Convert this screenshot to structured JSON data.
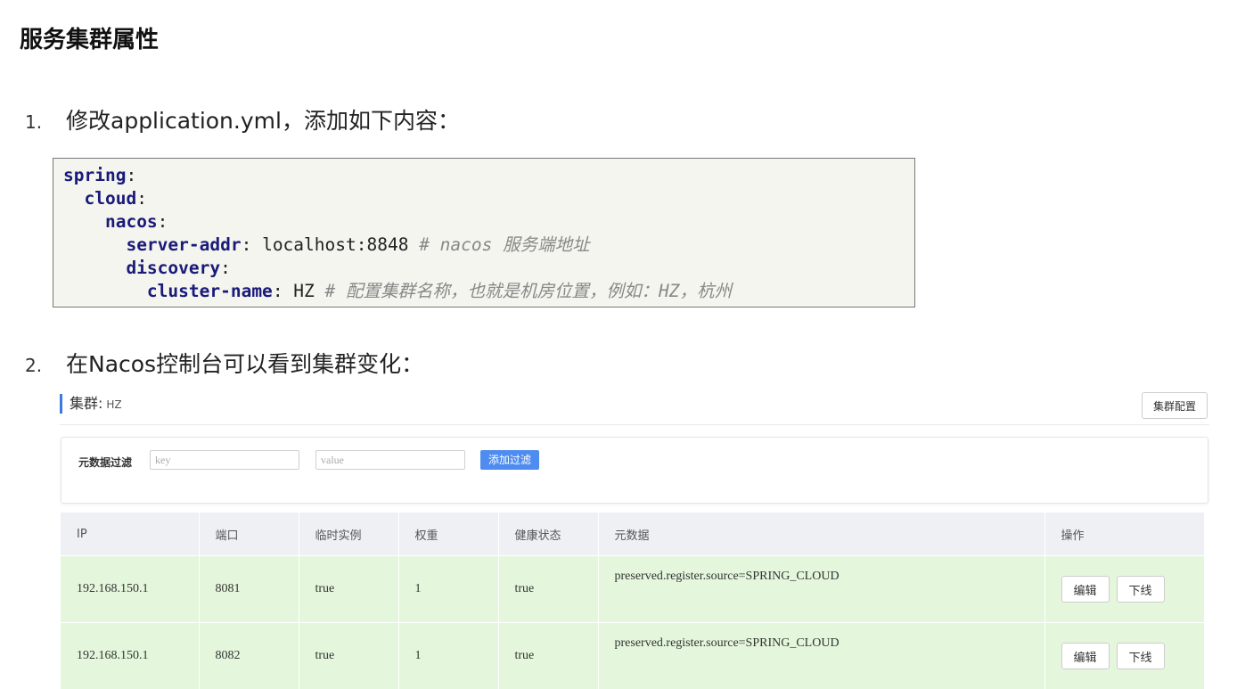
{
  "page_title": "服务集群属性",
  "steps": [
    {
      "number": "1.",
      "text": "修改application.yml，添加如下内容："
    },
    {
      "number": "2.",
      "text": "在Nacos控制台可以看到集群变化："
    }
  ],
  "code": {
    "spring": "spring",
    "cloud": "cloud",
    "nacos": "nacos",
    "server_addr_key": "server-addr",
    "server_addr_value": "localhost:8848",
    "server_addr_comment": "# nacos 服务端地址",
    "discovery": "discovery",
    "cluster_name_key": "cluster-name",
    "cluster_name_value": "HZ",
    "cluster_name_comment": "# 配置集群名称，也就是机房位置，例如：HZ，杭州"
  },
  "console": {
    "cluster_label": "集群:",
    "cluster_value": "HZ",
    "cluster_config_button": "集群配置",
    "filter": {
      "label": "元数据过滤",
      "key_placeholder": "key",
      "value_placeholder": "value",
      "add_button": "添加过滤"
    },
    "table": {
      "headers": [
        "IP",
        "端口",
        "临时实例",
        "权重",
        "健康状态",
        "元数据",
        "操作"
      ],
      "rows": [
        {
          "ip": "192.168.150.1",
          "port": "8081",
          "ephemeral": "true",
          "weight": "1",
          "healthy": "true",
          "metadata": "preserved.register.source=SPRING_CLOUD",
          "edit": "编辑",
          "offline": "下线"
        },
        {
          "ip": "192.168.150.1",
          "port": "8082",
          "ephemeral": "true",
          "weight": "1",
          "healthy": "true",
          "metadata": "preserved.register.source=SPRING_CLOUD",
          "edit": "编辑",
          "offline": "下线"
        }
      ]
    }
  }
}
